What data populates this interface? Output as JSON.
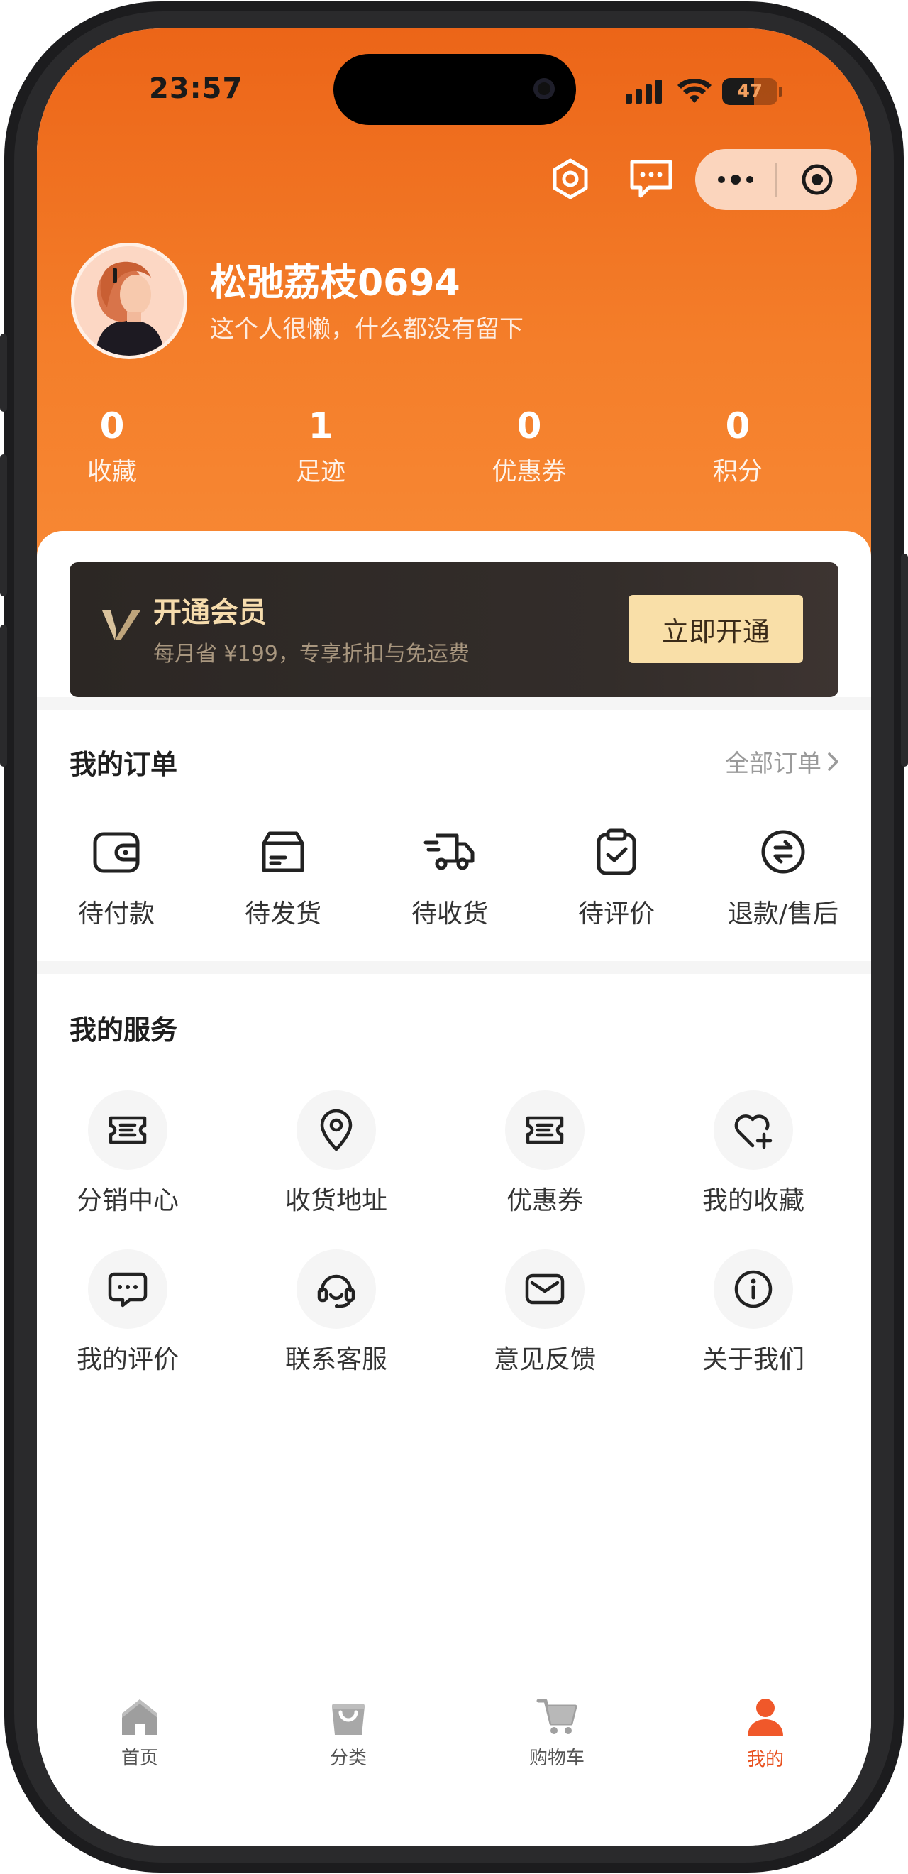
{
  "status_bar": {
    "time": "23:57",
    "battery": "47"
  },
  "profile": {
    "name": "松弛荔枝0694",
    "bio": "这个人很懒，什么都没有留下"
  },
  "stats": [
    {
      "value": "0",
      "label": "收藏"
    },
    {
      "value": "1",
      "label": "足迹"
    },
    {
      "value": "0",
      "label": "优惠券"
    },
    {
      "value": "0",
      "label": "积分"
    }
  ],
  "vip": {
    "title": "开通会员",
    "subtitle": "每月省 ¥199，专享折扣与免运费",
    "button": "立即开通"
  },
  "orders": {
    "title": "我的订单",
    "all_link": "全部订单",
    "items": [
      {
        "label": "待付款",
        "icon": "wallet-icon"
      },
      {
        "label": "待发货",
        "icon": "package-icon"
      },
      {
        "label": "待收货",
        "icon": "truck-icon"
      },
      {
        "label": "待评价",
        "icon": "clipboard-check-icon"
      },
      {
        "label": "退款/售后",
        "icon": "refund-icon"
      }
    ]
  },
  "services": {
    "title": "我的服务",
    "items": [
      {
        "label": "分销中心",
        "icon": "ticket-icon"
      },
      {
        "label": "收货地址",
        "icon": "location-pin-icon"
      },
      {
        "label": "优惠券",
        "icon": "coupon-icon"
      },
      {
        "label": "我的收藏",
        "icon": "heart-plus-icon"
      },
      {
        "label": "我的评价",
        "icon": "chat-bubble-icon"
      },
      {
        "label": "联系客服",
        "icon": "headset-icon"
      },
      {
        "label": "意见反馈",
        "icon": "mail-icon"
      },
      {
        "label": "关于我们",
        "icon": "info-icon"
      }
    ]
  },
  "tabbar": {
    "items": [
      {
        "label": "首页",
        "icon": "home-icon"
      },
      {
        "label": "分类",
        "icon": "bag-icon"
      },
      {
        "label": "购物车",
        "icon": "cart-icon"
      },
      {
        "label": "我的",
        "icon": "user-icon",
        "active": true
      }
    ]
  },
  "colors": {
    "accent": "#ef6c1f",
    "tab_active": "#e8511f",
    "vip_gold": "#f9dfa8"
  }
}
